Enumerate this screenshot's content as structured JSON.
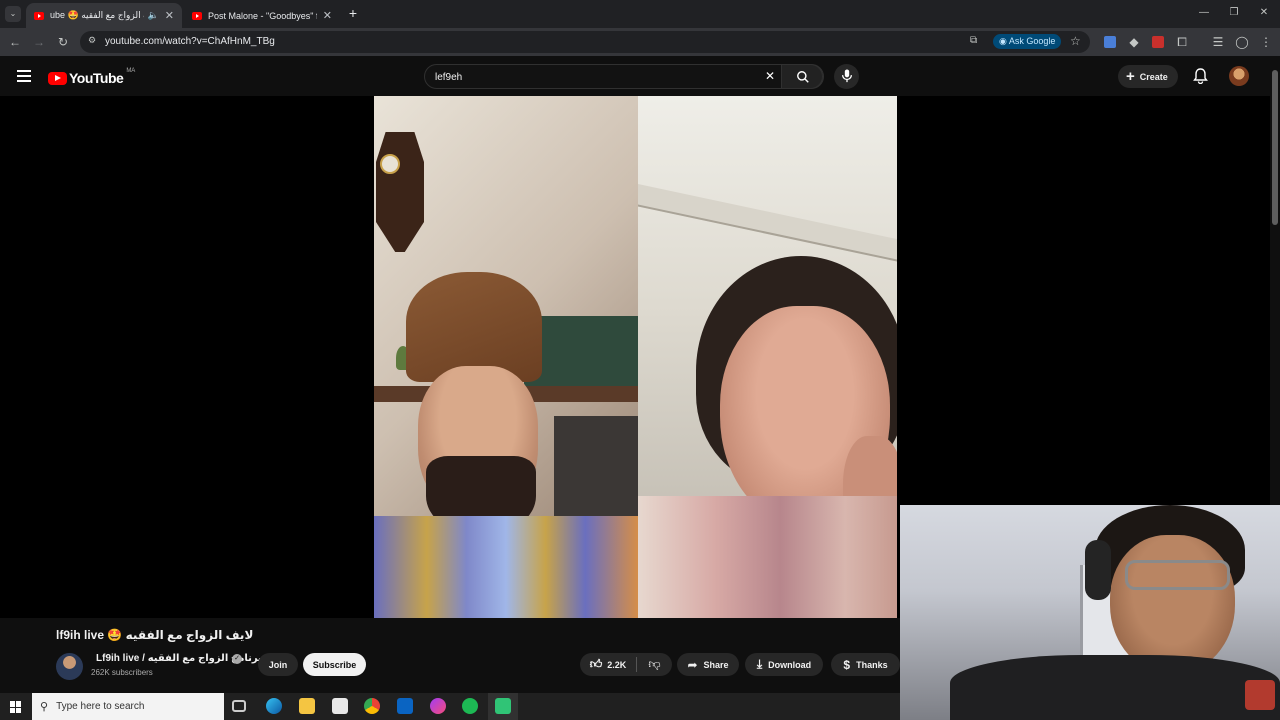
{
  "browser": {
    "tabs": [
      {
        "title": "ube 🤩 لايف الزواج مع الفقيه",
        "active": true,
        "audio": true
      },
      {
        "title": "Post Malone - \"Goodbyes\" ft. Yo",
        "active": false
      }
    ],
    "url": "youtube.com/watch?v=ChAfHnM_TBg",
    "ask_google": "Ask Google"
  },
  "youtube": {
    "logo_text": "YouTube",
    "country_code": "MA",
    "search_value": "lef9eh",
    "create_label": "Create"
  },
  "video": {
    "title": "lf9ih live 🤩 لايف الزواج مع الفقيه",
    "channel_name": "Lf9ih live / برنامج الزواج مع الفقيه",
    "subscribers": "262K subscribers",
    "join_label": "Join",
    "subscribe_label": "Subscribe",
    "like_count": "2.2K",
    "share_label": "Share",
    "download_label": "Download",
    "thanks_label": "Thanks"
  },
  "taskbar": {
    "search_placeholder": "Type here to search"
  },
  "colors": {
    "yt_red": "#ff0000",
    "background": "#0f0f0f",
    "pill": "#272727",
    "ask_google_bg": "#004a77"
  }
}
